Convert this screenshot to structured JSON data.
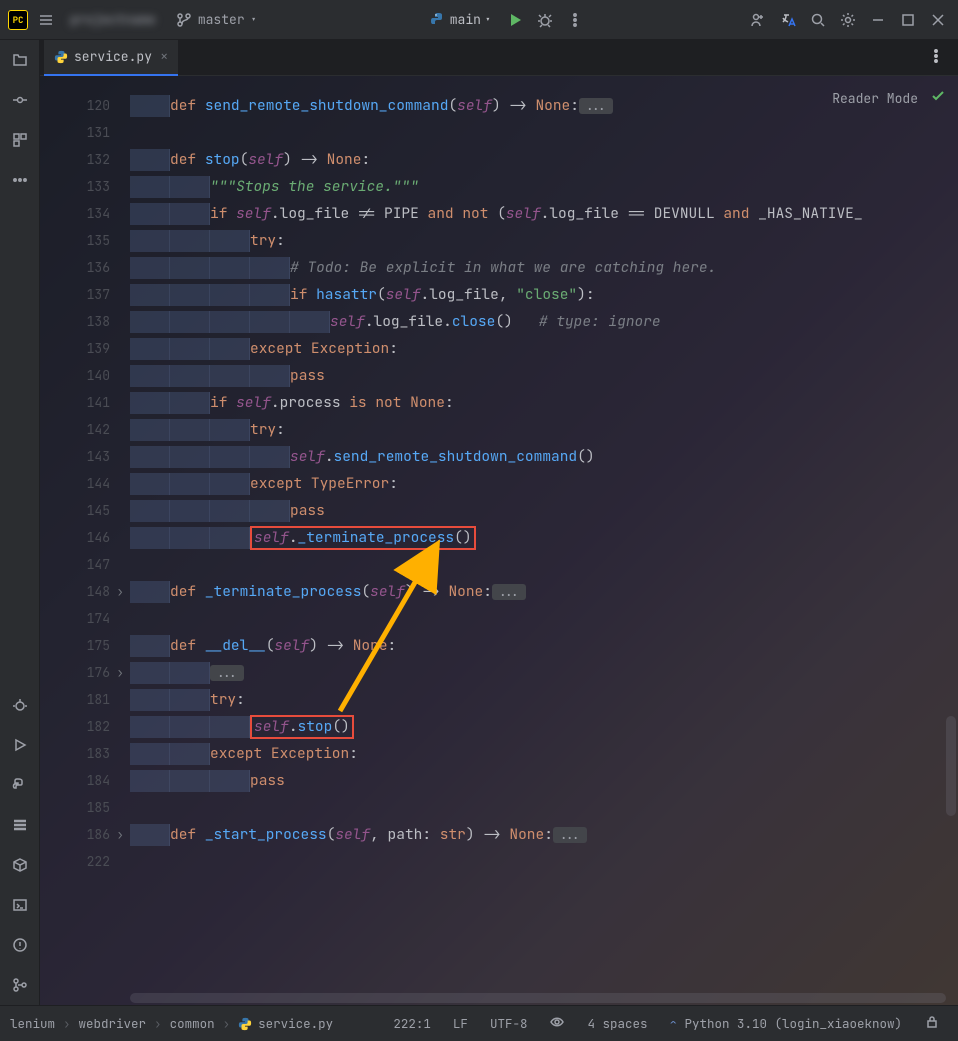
{
  "titlebar": {
    "logo": "PC",
    "project": "projectname",
    "branch": "master",
    "run_config": "main"
  },
  "tab": {
    "filename": "service.py"
  },
  "reader_mode": "Reader Mode",
  "gutter": [
    "120",
    "131",
    "132",
    "133",
    "134",
    "135",
    "136",
    "137",
    "138",
    "139",
    "140",
    "141",
    "142",
    "143",
    "144",
    "145",
    "146",
    "147",
    "148",
    "174",
    "175",
    "176",
    "181",
    "182",
    "183",
    "184",
    "185",
    "186",
    "222"
  ],
  "code": {
    "l120": {
      "def": "def ",
      "fn": "send_remote_shutdown_command",
      "op1": "(",
      "self": "self",
      "op2": ") -> ",
      "ret": "None",
      "colon": ":",
      "fold": "..."
    },
    "l132": {
      "def": "def ",
      "fn": "stop",
      "op1": "(",
      "self": "self",
      "op2": ") -> ",
      "ret": "None",
      "colon": ":"
    },
    "l133": {
      "doc": "\"\"\"Stops the service.\"\"\""
    },
    "l134": {
      "kw1": "if ",
      "self": "self",
      "attr": ".log_file != PIPE ",
      "kw2": "and not ",
      "op": "(",
      "self2": "self",
      "rest": ".log_file == DEVNULL ",
      "kw3": "and ",
      "tail": "_HAS_NATIVE_"
    },
    "l135": {
      "kw": "try",
      "colon": ":"
    },
    "l136": {
      "cm": "# Todo: Be explicit in what we are catching here."
    },
    "l137": {
      "kw": "if ",
      "fn": "hasattr",
      "op": "(",
      "self": "self",
      "mid": ".log_file, ",
      "str": "\"close\"",
      "close": "):"
    },
    "l138": {
      "self": "self",
      "mid": ".log_file.",
      "fn": "close",
      "op": "()",
      "sp": "   ",
      "cm": "# type: ignore"
    },
    "l139": {
      "kw": "except ",
      "ty": "Exception",
      "colon": ":"
    },
    "l140": {
      "kw": "pass"
    },
    "l141": {
      "kw1": "if ",
      "self": "self",
      "mid": ".process ",
      "kw2": "is not ",
      "none": "None",
      "colon": ":"
    },
    "l142": {
      "kw": "try",
      "colon": ":"
    },
    "l143": {
      "self": "self",
      "dot": ".",
      "fn": "send_remote_shutdown_command",
      "op": "()"
    },
    "l144": {
      "kw": "except ",
      "ty": "TypeError",
      "colon": ":"
    },
    "l145": {
      "kw": "pass"
    },
    "l146": {
      "self": "self",
      "dot": ".",
      "fn": "_terminate_process",
      "op": "()"
    },
    "l148": {
      "def": "def ",
      "fn": "_terminate_process",
      "op1": "(",
      "self": "self",
      "op2": ") -> ",
      "ret": "None",
      "colon": ":",
      "fold": "..."
    },
    "l175": {
      "def": "def ",
      "fn": "__del__",
      "op1": "(",
      "self": "self",
      "op2": ") -> ",
      "ret": "None",
      "colon": ":"
    },
    "l176": {
      "fold": "..."
    },
    "l181": {
      "kw": "try",
      "colon": ":"
    },
    "l182": {
      "self": "self",
      "dot": ".",
      "fn": "stop",
      "op": "()"
    },
    "l183": {
      "kw": "except ",
      "ty": "Exception",
      "colon": ":"
    },
    "l184": {
      "kw": "pass"
    },
    "l186": {
      "def": "def ",
      "fn": "_start_process",
      "op1": "(",
      "self": "self",
      "comma": ", ",
      "path": "path",
      "tcolon": ": ",
      "ty": "str",
      "op2": ") -> ",
      "ret": "None",
      "colon": ":",
      "fold": "..."
    }
  },
  "status": {
    "crumb1": "lenium",
    "crumb2": "webdriver",
    "crumb3": "common",
    "crumb4": "service.py",
    "pos": "222:1",
    "le": "LF",
    "enc": "UTF-8",
    "indent": "4 spaces",
    "py": "Python 3.10 (login_xiaoeknow)"
  }
}
